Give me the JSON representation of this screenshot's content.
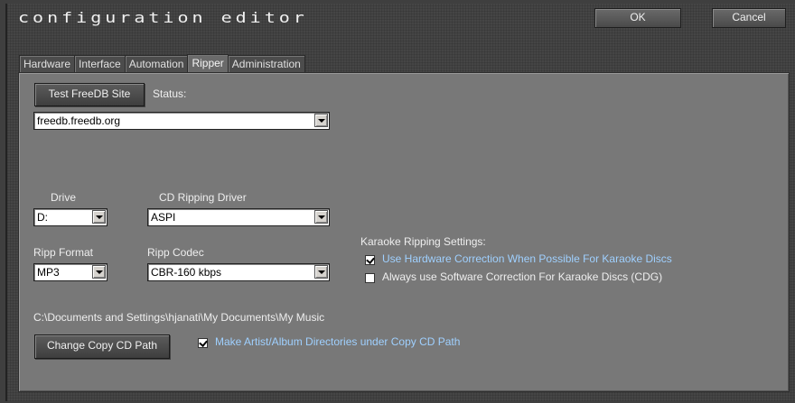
{
  "window": {
    "title": "configuration editor",
    "ok_label": "OK",
    "cancel_label": "Cancel"
  },
  "tabs": [
    {
      "label": "Hardware",
      "active": false
    },
    {
      "label": "Interface",
      "active": false
    },
    {
      "label": "Automation",
      "active": false
    },
    {
      "label": "Ripper",
      "active": true
    },
    {
      "label": "Administration",
      "active": false
    }
  ],
  "freedb": {
    "test_button": "Test FreeDB Site",
    "status_label": "Status:",
    "server": "freedb.freedb.org"
  },
  "drive": {
    "label": "Drive",
    "value": "D:"
  },
  "driver": {
    "label": "CD Ripping Driver",
    "value": "ASPI"
  },
  "format": {
    "label": "Ripp Format",
    "value": "MP3"
  },
  "codec": {
    "label": "Ripp Codec",
    "value": "CBR-160 kbps"
  },
  "karaoke": {
    "heading": "Karaoke Ripping Settings:",
    "hardware_correction": {
      "label": "Use Hardware Correction When Possible For Karaoke Discs",
      "checked": true
    },
    "software_correction": {
      "label": "Always use Software Correction For Karaoke Discs (CDG)",
      "checked": false
    }
  },
  "copy_path": {
    "path": "C:\\Documents and Settings\\hjanati\\My Documents\\My Music",
    "change_button": "Change Copy CD Path",
    "make_dirs": {
      "label": "Make Artist/Album Directories under Copy CD Path",
      "checked": true
    }
  },
  "colors": {
    "accent_text": "#9fd0ff",
    "panel": "#787878",
    "frame": "#454545"
  }
}
